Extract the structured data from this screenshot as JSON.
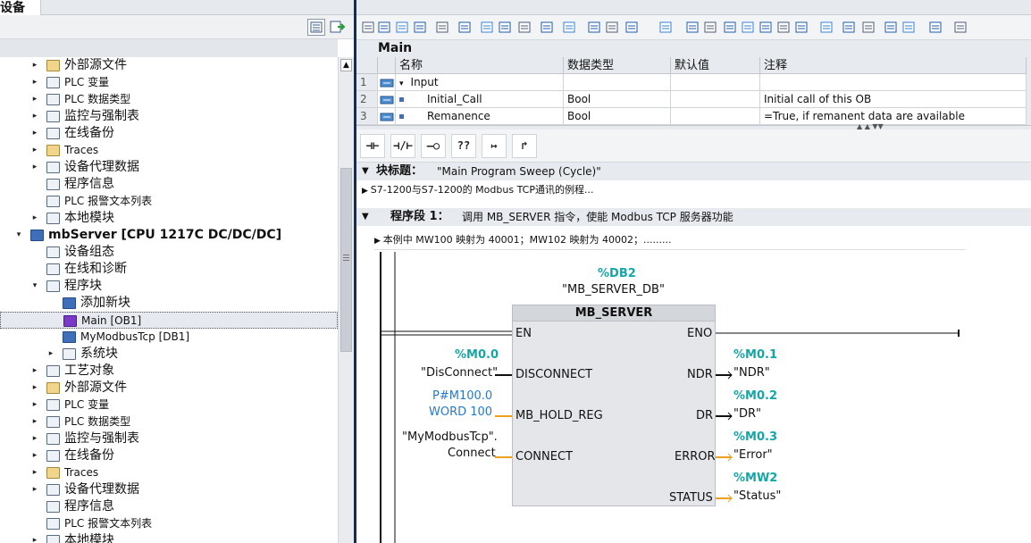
{
  "left_panel": {
    "title": "设备",
    "tree": [
      {
        "label": "外部源文件",
        "indent": 1,
        "arrow": "▸",
        "icon": "folder-icon"
      },
      {
        "label": "PLC 变量",
        "indent": 1,
        "arrow": "▸",
        "icon": "tag-table-icon"
      },
      {
        "label": "PLC 数据类型",
        "indent": 1,
        "arrow": "▸",
        "icon": "data-type-icon"
      },
      {
        "label": "监控与强制表",
        "indent": 1,
        "arrow": "▸",
        "icon": "watch-table-icon"
      },
      {
        "label": "在线备份",
        "indent": 1,
        "arrow": "▸",
        "icon": "backup-icon"
      },
      {
        "label": "Traces",
        "indent": 1,
        "arrow": "▸",
        "icon": "traces-icon"
      },
      {
        "label": "设备代理数据",
        "indent": 1,
        "arrow": "▸",
        "icon": "proxy-icon"
      },
      {
        "label": "程序信息",
        "indent": 1,
        "arrow": "",
        "icon": "program-info-icon"
      },
      {
        "label": "PLC 报警文本列表",
        "indent": 1,
        "arrow": "",
        "icon": "alarm-text-icon"
      },
      {
        "label": "本地模块",
        "indent": 1,
        "arrow": "▸",
        "icon": "local-modules-icon"
      },
      {
        "label": "mbServer [CPU 1217C DC/DC/DC]",
        "indent": 0,
        "arrow": "▾",
        "icon": "cpu-icon",
        "bold": true
      },
      {
        "label": "设备组态",
        "indent": 1,
        "arrow": "",
        "icon": "device-config-icon"
      },
      {
        "label": "在线和诊断",
        "indent": 1,
        "arrow": "",
        "icon": "diagnostics-icon"
      },
      {
        "label": "程序块",
        "indent": 1,
        "arrow": "▾",
        "icon": "program-blocks-icon"
      },
      {
        "label": "添加新块",
        "indent": 2,
        "arrow": "",
        "icon": "add-block-icon"
      },
      {
        "label": "Main [OB1]",
        "indent": 2,
        "arrow": "",
        "icon": "ob-icon",
        "selected": true
      },
      {
        "label": "MyModbusTcp [DB1]",
        "indent": 2,
        "arrow": "",
        "icon": "db-icon"
      },
      {
        "label": "系统块",
        "indent": 2,
        "arrow": "▸",
        "icon": "system-blocks-icon"
      },
      {
        "label": "工艺对象",
        "indent": 1,
        "arrow": "▸",
        "icon": "technology-objects-icon"
      },
      {
        "label": "外部源文件",
        "indent": 1,
        "arrow": "▸",
        "icon": "folder-icon"
      },
      {
        "label": "PLC 变量",
        "indent": 1,
        "arrow": "▸",
        "icon": "tag-table-icon"
      },
      {
        "label": "PLC 数据类型",
        "indent": 1,
        "arrow": "▸",
        "icon": "data-type-icon"
      },
      {
        "label": "监控与强制表",
        "indent": 1,
        "arrow": "▸",
        "icon": "watch-table-icon"
      },
      {
        "label": "在线备份",
        "indent": 1,
        "arrow": "▸",
        "icon": "backup-icon"
      },
      {
        "label": "Traces",
        "indent": 1,
        "arrow": "▸",
        "icon": "traces-icon"
      },
      {
        "label": "设备代理数据",
        "indent": 1,
        "arrow": "▸",
        "icon": "proxy-icon"
      },
      {
        "label": "程序信息",
        "indent": 1,
        "arrow": "",
        "icon": "program-info-icon"
      },
      {
        "label": "PLC 报警文本列表",
        "indent": 1,
        "arrow": "",
        "icon": "alarm-text-icon"
      },
      {
        "label": "本地模块",
        "indent": 1,
        "arrow": "▸",
        "icon": "local-modules-icon"
      }
    ]
  },
  "editor": {
    "block_name": "Main",
    "interface": {
      "columns": [
        "名称",
        "数据类型",
        "默认值",
        "注释"
      ],
      "rows": [
        {
          "num": "1",
          "name": "Input",
          "type": "",
          "default": "",
          "comment": "",
          "expand": "▾"
        },
        {
          "num": "2",
          "name": "Initial_Call",
          "type": "Bool",
          "default": "",
          "comment": "Initial call of this OB"
        },
        {
          "num": "3",
          "name": "Remanence",
          "type": "Bool",
          "default": "",
          "comment": "=True, if remanent data are available"
        }
      ]
    },
    "ladder_buttons": [
      "⊣⊢",
      "⊣/⊢",
      "–○",
      "??",
      "↦",
      "↱"
    ],
    "block_title_label": "块标题：",
    "block_title_value": "\"Main Program Sweep (Cycle)\"",
    "block_comment": "S7-1200与S7-1200的 Modbus TCP通讯的例程...",
    "network_label": "程序段 1：",
    "network_title": "调用 MB_SERVER 指令，使能 Modbus TCP 服务器功能",
    "network_comment": "本例中 MW100 映射为 40001；MW102 映射为 40002；.........",
    "instance_db": "%DB2",
    "instance_db_name": "\"MB_SERVER_DB\"",
    "fb_name": "MB_SERVER",
    "inputs": [
      {
        "pin": "EN",
        "addr": "",
        "value": ""
      },
      {
        "pin": "DISCONNECT",
        "addr": "%M0.0",
        "value": "\"DisConnect\""
      },
      {
        "pin": "MB_HOLD_REG",
        "addr": "P#M100.0",
        "value": "WORD 100"
      },
      {
        "pin": "CONNECT",
        "addr": "\"MyModbusTcp\".",
        "value": "Connect"
      }
    ],
    "outputs": [
      {
        "pin": "ENO",
        "addr": "",
        "value": ""
      },
      {
        "pin": "NDR",
        "addr": "%M0.1",
        "value": "\"NDR\""
      },
      {
        "pin": "DR",
        "addr": "%M0.2",
        "value": "\"DR\""
      },
      {
        "pin": "ERROR",
        "addr": "%M0.3",
        "value": "\"Error\""
      },
      {
        "pin": "STATUS",
        "addr": "%MW2",
        "value": "\"Status\""
      }
    ]
  },
  "colors": {
    "teal": "#15a6a6",
    "blue": "#2a78c8",
    "wire_orange": "#f0a020",
    "block_fill": "#e4e6ea"
  }
}
